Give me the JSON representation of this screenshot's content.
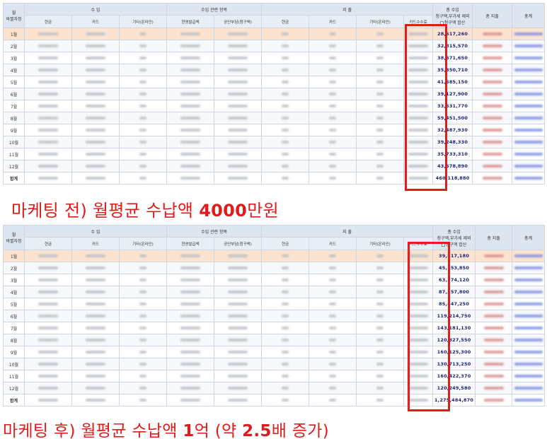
{
  "header": {
    "month_col": "월",
    "month_sub": "바뀔자정",
    "income_group": "수 입",
    "related_group": "수입 관련 항목",
    "expense_group": "지 출",
    "income_total": "총 수입",
    "income_total_sub": "청구액,부가세 제외",
    "income_total_check": "청구액 합산",
    "expense_total": "총 지출",
    "net": "총계",
    "income_cols": [
      "현금",
      "카드",
      "기타(온라인)"
    ],
    "related_cols": [
      "현영발급액",
      "공단부담(청구액)"
    ],
    "expense_cols": [
      "현금",
      "카드",
      "기타(온라인)",
      "카드수수료"
    ]
  },
  "before": {
    "months": [
      "1월",
      "2월",
      "3월",
      "4월",
      "5월",
      "6월",
      "7월",
      "8월",
      "9월",
      "10월",
      "11월",
      "12월",
      "합계"
    ],
    "totals": [
      "28,517,260",
      "32,815,570",
      "38,571,650",
      "35,350,710",
      "41,585,150",
      "39,127,900",
      "33,531,770",
      "59,451,500",
      "32,487,930",
      "39,248,330",
      "35,733,310",
      "43,578,890",
      "460,118,880"
    ],
    "caption_prefix": "마케팅 전) 월평균 수납액 ",
    "caption_amount": "4000",
    "caption_suffix": "만원"
  },
  "after": {
    "months": [
      "1월",
      "2월",
      "3월",
      "4월",
      "5월",
      "6월",
      "7월",
      "8월",
      "9월",
      "10월",
      "11월",
      "12월",
      "합계"
    ],
    "totals": [
      "39,517,180",
      "45,153,850",
      "63,374,120",
      "87,357,800",
      "85,847,250",
      "119,214,750",
      "143,181,130",
      "120,327,550",
      "160,125,300",
      "130,713,250",
      "160,422,370",
      "120,249,580",
      "1,275,484,870"
    ],
    "caption_prefix": "마케팅 후) 월평균 수납액 ",
    "caption_amount_1": "1",
    "caption_mid": "억 (약 ",
    "caption_amount_2": "2.5",
    "caption_suffix": "배 증가)"
  },
  "colors": {
    "accent_red": "#e21b1b",
    "first_row": "#fbe3cf",
    "header": "#dde6f0",
    "total_text": "#1a237e"
  }
}
